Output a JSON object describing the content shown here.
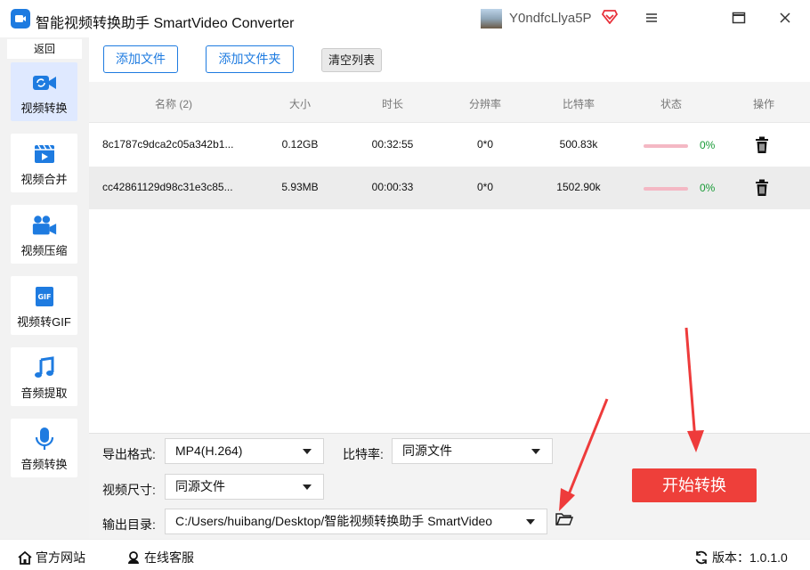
{
  "app": {
    "title": "智能视频转换助手 SmartVideo Converter",
    "username": "Y0ndfcLlya5P",
    "brand_color": "#1e7be0"
  },
  "sidebar": {
    "back_label": "返回",
    "items": [
      {
        "label": "视频转换",
        "icon": "video-convert-icon",
        "active": true
      },
      {
        "label": "视频合并",
        "icon": "film-merge-icon",
        "active": false
      },
      {
        "label": "视频压缩",
        "icon": "camera-compress-icon",
        "active": false
      },
      {
        "label": "视频转GIF",
        "icon": "gif-icon",
        "active": false
      },
      {
        "label": "音频提取",
        "icon": "music-note-icon",
        "active": false
      },
      {
        "label": "音频转换",
        "icon": "microphone-icon",
        "active": false
      }
    ]
  },
  "toolbar": {
    "add_file": "添加文件",
    "add_folder": "添加文件夹",
    "clear_list": "清空列表"
  },
  "table": {
    "headers": {
      "name": "名称 (2)",
      "size": "大小",
      "duration": "时长",
      "resolution": "分辨率",
      "bitrate": "比特率",
      "status": "状态",
      "action": "操作"
    },
    "rows": [
      {
        "name": "8c1787c9dca2c05a342b1...",
        "size": "0.12GB",
        "duration": "00:32:55",
        "resolution": "0*0",
        "bitrate": "500.83k",
        "progress": "0%"
      },
      {
        "name": "cc42861129d98c31e3c85...",
        "size": "5.93MB",
        "duration": "00:00:33",
        "resolution": "0*0",
        "bitrate": "1502.90k",
        "progress": "0%"
      }
    ]
  },
  "settings": {
    "format_label": "导出格式:",
    "format_value": "MP4(H.264)",
    "bitrate_label": "比特率:",
    "bitrate_value": "同源文件",
    "size_label": "视频尺寸:",
    "size_value": "同源文件",
    "output_label": "输出目录:",
    "output_value": "C:/Users/huibang/Desktop/智能视频转换助手 SmartVideo"
  },
  "start_button": "开始转换",
  "footer": {
    "website": "官方网站",
    "service": "在线客服",
    "version": "版本：1.0.1.0"
  }
}
